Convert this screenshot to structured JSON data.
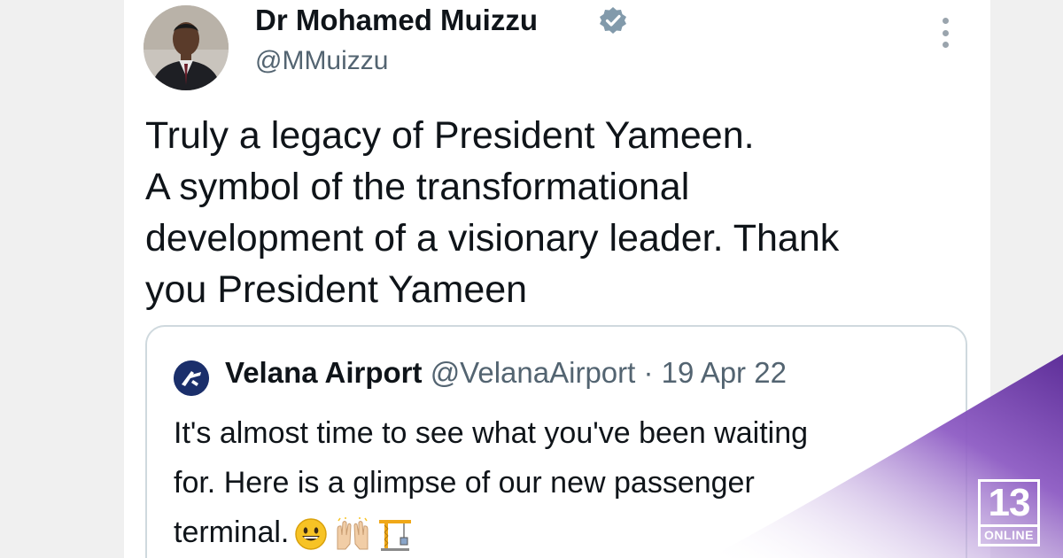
{
  "author": {
    "display_name": "Dr Mohamed Muizzu",
    "handle": "@MMuizzu",
    "verified": true
  },
  "tweet": {
    "lines": [
      "Truly a legacy of President Yameen.",
      "A symbol of the transformational",
      "development of a visionary leader. Thank",
      "you President Yameen"
    ]
  },
  "quoted_tweet": {
    "name": "Velana Airport",
    "meta": "@VelanaAirport · 19 Apr 22",
    "lines": [
      "It's almost time to see what you've been waiting",
      "for. Here is a glimpse of our new passenger",
      "terminal."
    ],
    "emojis": [
      "grinning-face",
      "raising-hands",
      "building-construction"
    ]
  },
  "branding": {
    "number": "13",
    "label": "ONLINE"
  },
  "colors": {
    "text_primary": "#0f1419",
    "text_secondary": "#536471",
    "verified_badge": "#829aab",
    "card_border": "#cfd9de",
    "brand_gradient": "#7b4fb0"
  }
}
